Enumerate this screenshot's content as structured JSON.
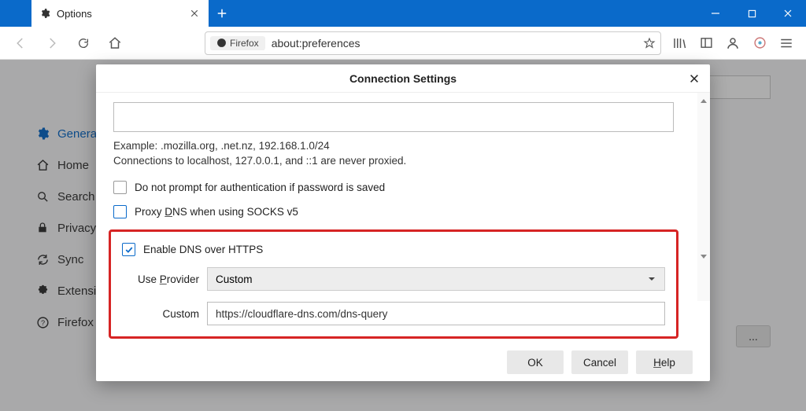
{
  "titlebar": {
    "tab_title": "Options"
  },
  "toolbar": {
    "badge": "Firefox",
    "url": "about:preferences"
  },
  "sidebar": {
    "items": [
      {
        "label": "General"
      },
      {
        "label": "Home"
      },
      {
        "label": "Search"
      },
      {
        "label": "Privacy & Security"
      },
      {
        "label": "Sync"
      },
      {
        "label": "Extensions & Themes"
      },
      {
        "label": "Firefox Support"
      }
    ]
  },
  "bg": {
    "dots": "..."
  },
  "dialog": {
    "title": "Connection Settings",
    "example": "Example: .mozilla.org, .net.nz, 192.168.1.0/24",
    "note": "Connections to localhost, 127.0.0.1, and ::1 are never proxied.",
    "check_noprompt": "Do not prompt for authentication if password is saved",
    "check_proxydns_pre": "Proxy ",
    "check_proxydns_u": "D",
    "check_proxydns_post": "NS when using SOCKS v5",
    "check_doh": "Enable DNS over HTTPS",
    "label_provider_pre": "Use ",
    "label_provider_u": "P",
    "label_provider_post": "rovider",
    "provider_value": "Custom",
    "label_custom": "Custom",
    "custom_value": "https://cloudflare-dns.com/dns-query",
    "btn_ok": "OK",
    "btn_cancel": "Cancel",
    "btn_help_u": "H",
    "btn_help_post": "elp"
  }
}
